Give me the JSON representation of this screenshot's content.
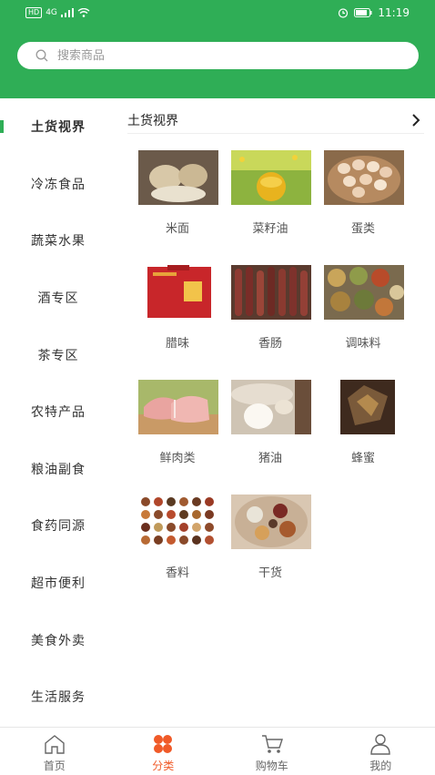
{
  "status_bar": {
    "hd": "HD",
    "net": "4G",
    "time": "11:19"
  },
  "search": {
    "placeholder": "搜索商品"
  },
  "sidebar": {
    "items": [
      {
        "label": "土货视界"
      },
      {
        "label": "冷冻食品"
      },
      {
        "label": "蔬菜水果"
      },
      {
        "label": "酒专区"
      },
      {
        "label": "茶专区"
      },
      {
        "label": "农特产品"
      },
      {
        "label": "粮油副食"
      },
      {
        "label": "食药同源"
      },
      {
        "label": "超市便利"
      },
      {
        "label": "美食外卖"
      },
      {
        "label": "生活服务"
      }
    ]
  },
  "section": {
    "title": "土货视界"
  },
  "products": [
    {
      "label": "米面"
    },
    {
      "label": "菜籽油"
    },
    {
      "label": "蛋类"
    },
    {
      "label": "腊味"
    },
    {
      "label": "香肠"
    },
    {
      "label": "调味料"
    },
    {
      "label": "鲜肉类"
    },
    {
      "label": "猪油"
    },
    {
      "label": "蜂蜜"
    },
    {
      "label": "香料"
    },
    {
      "label": "干货"
    }
  ],
  "tabbar": {
    "tabs": [
      {
        "label": "首页"
      },
      {
        "label": "分类"
      },
      {
        "label": "购物车"
      },
      {
        "label": "我的"
      }
    ]
  },
  "colors": {
    "brand_green": "#2fae56",
    "active_orange": "#f05a28"
  }
}
